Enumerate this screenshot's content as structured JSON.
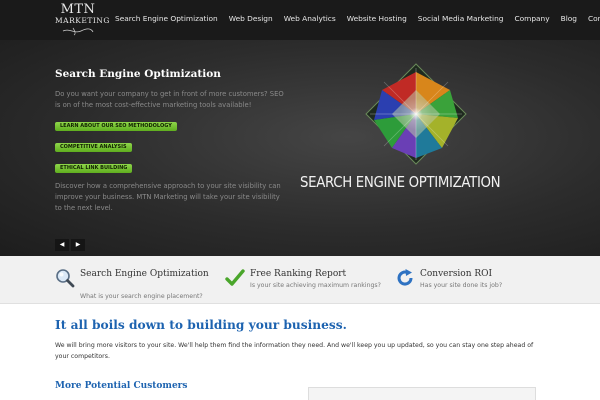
{
  "colors": {
    "header_bg": "#1a1a1a",
    "accent_blue": "#1d63b0",
    "button_green": "#7ac142",
    "features_bg": "#f1f1f1"
  },
  "header": {
    "logo_line1": "MTN",
    "logo_line2": "MARKETING",
    "nav": [
      "Search Engine Optimization",
      "Web Design",
      "Web Analytics",
      "Website Hosting",
      "Social Media Marketing",
      "Company",
      "Blog",
      "Contact"
    ]
  },
  "hero": {
    "title": "Search Engine Optimization",
    "text1": "Do you want your company to get in front of more customers? SEO is on of the most cost-effective marketing tools available!",
    "buttons": [
      "LEARN ABOUT OUR SEO METHODOLOGY",
      "COMPETITIVE ANALYSIS",
      "ETHICAL LINK BUILDING"
    ],
    "text2": "Discover how a comprehensive approach to your site visibility can improve your business. MTN Marketing will take your site visibility to the next level.",
    "graphic_text": "SEARCH ENGINE OPTIMIZATION",
    "graphic_icon": "seo-gem-icon",
    "prev_label": "◀",
    "next_label": "▶"
  },
  "features": [
    {
      "icon": "magnifier-icon",
      "title": "Search Engine Optimization",
      "subtitle": "What is your search engine placement?"
    },
    {
      "icon": "checkmark-icon",
      "title": "Free Ranking Report",
      "subtitle": "Is your site achieving maximum rankings?"
    },
    {
      "icon": "refresh-icon",
      "title": "Conversion ROI",
      "subtitle": "Has your site done its job?"
    }
  ],
  "main": {
    "heading": "It all boils down to building your business.",
    "text": "We will bring more visitors to your site. We'll help them find the information they need. And we'll keep you up updated, so you can stay one step ahead of your competitors.",
    "subheading": "More Potential Customers"
  }
}
